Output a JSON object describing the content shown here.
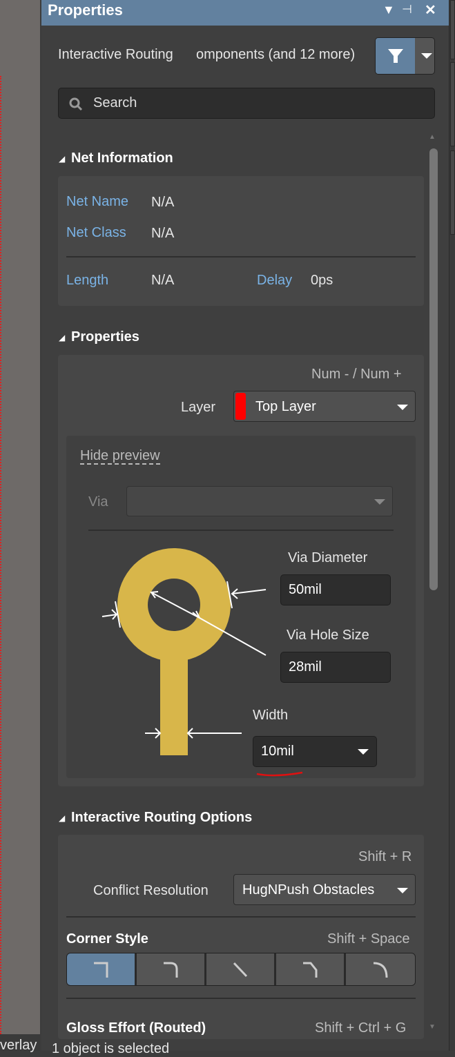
{
  "panel": {
    "title": "Properties",
    "header_colors": {
      "bar": "#62819f"
    }
  },
  "filter": {
    "text_left": "Interactive Routing",
    "text_right": "omponents (and 12 more)"
  },
  "search": {
    "placeholder": "Search"
  },
  "net_information": {
    "title": "Net Information",
    "net_name_label": "Net Name",
    "net_name": "N/A",
    "net_class_label": "Net Class",
    "net_class": "N/A",
    "length_label": "Length",
    "length": "N/A",
    "delay_label": "Delay",
    "delay": "0ps"
  },
  "properties": {
    "title": "Properties",
    "shortcut": "Num - / Num +",
    "layer_label": "Layer",
    "layer_value": "Top Layer",
    "layer_color": "#ff0000",
    "hide_preview": "Hide preview",
    "via_label": "Via",
    "via_value": "",
    "via_diameter_label": "Via Diameter",
    "via_diameter": "50mil",
    "via_hole_label": "Via Hole Size",
    "via_hole": "28mil",
    "width_label": "Width",
    "width": "10mil"
  },
  "routing": {
    "title": "Interactive Routing Options",
    "conflict_shortcut": "Shift + R",
    "conflict_label": "Conflict Resolution",
    "conflict_value": "HugNPush Obstacles",
    "corner_label": "Corner Style",
    "corner_shortcut": "Shift + Space",
    "corner_styles": [
      "90 degree",
      "90 degree arc",
      "any angle",
      "45 degree",
      "45 degree arc"
    ],
    "corner_selected": 0,
    "gloss_label": "Gloss Effort (Routed)",
    "gloss_shortcut": "Shift + Ctrl + G"
  },
  "status": {
    "left": "verlay",
    "text": "1 object is selected"
  }
}
